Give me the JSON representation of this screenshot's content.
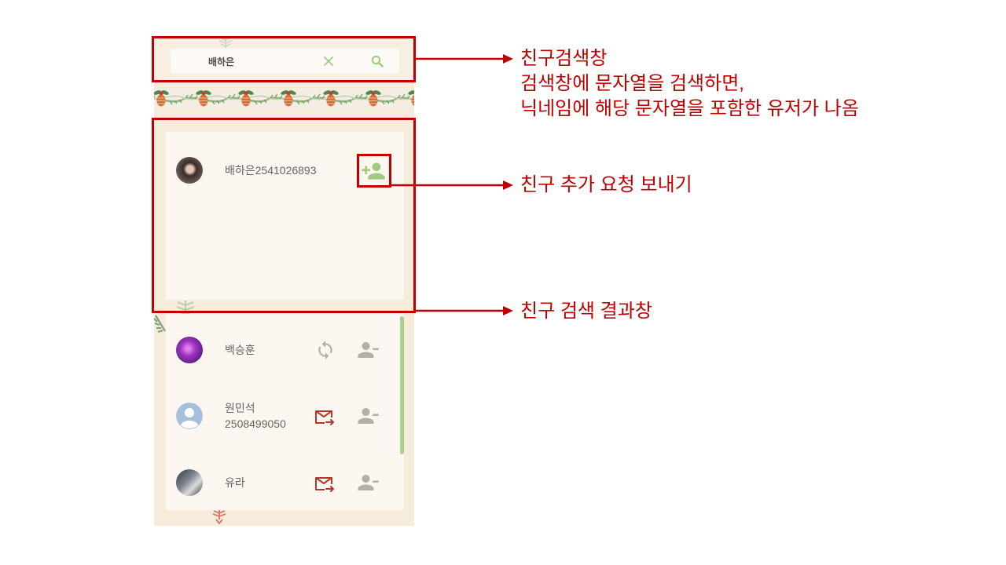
{
  "search": {
    "value": "배하은",
    "clear_icon": "close-icon",
    "submit_icon": "search-icon"
  },
  "search_results": [
    {
      "name": "배하은2541026893",
      "action_icon": "add-friend-icon"
    }
  ],
  "friends": [
    {
      "name": "백승훈",
      "action_icon": "refresh-icon",
      "remove_icon": "remove-friend-icon"
    },
    {
      "name": "원민석",
      "sub": "2508499050",
      "action_icon": "mail-send-icon",
      "remove_icon": "remove-friend-icon"
    },
    {
      "name": "유라",
      "action_icon": "mail-send-icon",
      "remove_icon": "remove-friend-icon"
    }
  ],
  "annotations": {
    "search_box": {
      "title": "친구검색창",
      "lines": [
        "검색창에 문자열을 검색하면,",
        "닉네임에 해당 문자열을 포함한 유저가 나옴"
      ]
    },
    "add_friend": "친구 추가 요청 보내기",
    "results": "친구 검색 결과창"
  },
  "colors": {
    "annotation_red": "#c00000",
    "accent_green": "#9ccc7e",
    "mail_red": "#b4372e",
    "icon_gray": "#b3afa9",
    "panel_bg": "#f7ebda",
    "card_bg": "#fcf7f1"
  }
}
